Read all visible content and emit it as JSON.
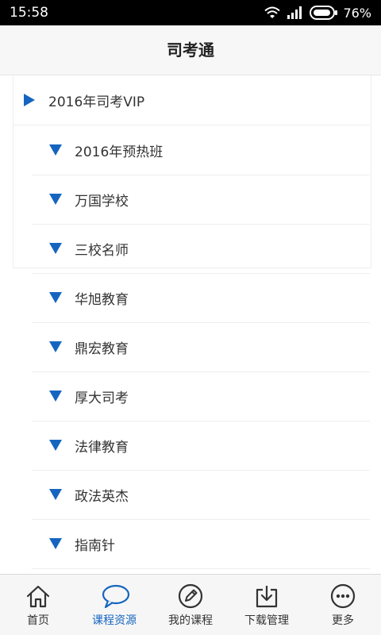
{
  "status_bar": {
    "time": "15:58",
    "battery": "76%",
    "icons": [
      "wifi-icon",
      "signal-icon",
      "battery-icon"
    ]
  },
  "title_bar": {
    "title": "司考通"
  },
  "tree": {
    "root": {
      "label": "2016年司考VIP",
      "icon": "triangle-right-icon"
    },
    "children": [
      {
        "label": "2016年预热班",
        "icon": "triangle-down-icon"
      },
      {
        "label": "万国学校",
        "icon": "triangle-down-icon"
      },
      {
        "label": "三校名师",
        "icon": "triangle-down-icon"
      },
      {
        "label": "华旭教育",
        "icon": "triangle-down-icon"
      },
      {
        "label": "鼎宏教育",
        "icon": "triangle-down-icon"
      },
      {
        "label": "厚大司考",
        "icon": "triangle-down-icon"
      },
      {
        "label": "法律教育",
        "icon": "triangle-down-icon"
      },
      {
        "label": "政法英杰",
        "icon": "triangle-down-icon"
      },
      {
        "label": "指南针",
        "icon": "triangle-down-icon"
      }
    ]
  },
  "bottom_nav": {
    "items": [
      {
        "label": "首页",
        "icon": "home-icon",
        "active": false
      },
      {
        "label": "课程资源",
        "icon": "chat-bubble-icon",
        "active": true
      },
      {
        "label": "我的课程",
        "icon": "edit-pencil-icon",
        "active": false
      },
      {
        "label": "下载管理",
        "icon": "download-icon",
        "active": false
      },
      {
        "label": "更多",
        "icon": "more-dots-icon",
        "active": false
      }
    ]
  },
  "colors": {
    "accent": "#1565c0",
    "status_bar": "#000000",
    "title_bar": "#f7f7f7",
    "nav_bar": "#f6f6f6",
    "text": "#333333"
  }
}
